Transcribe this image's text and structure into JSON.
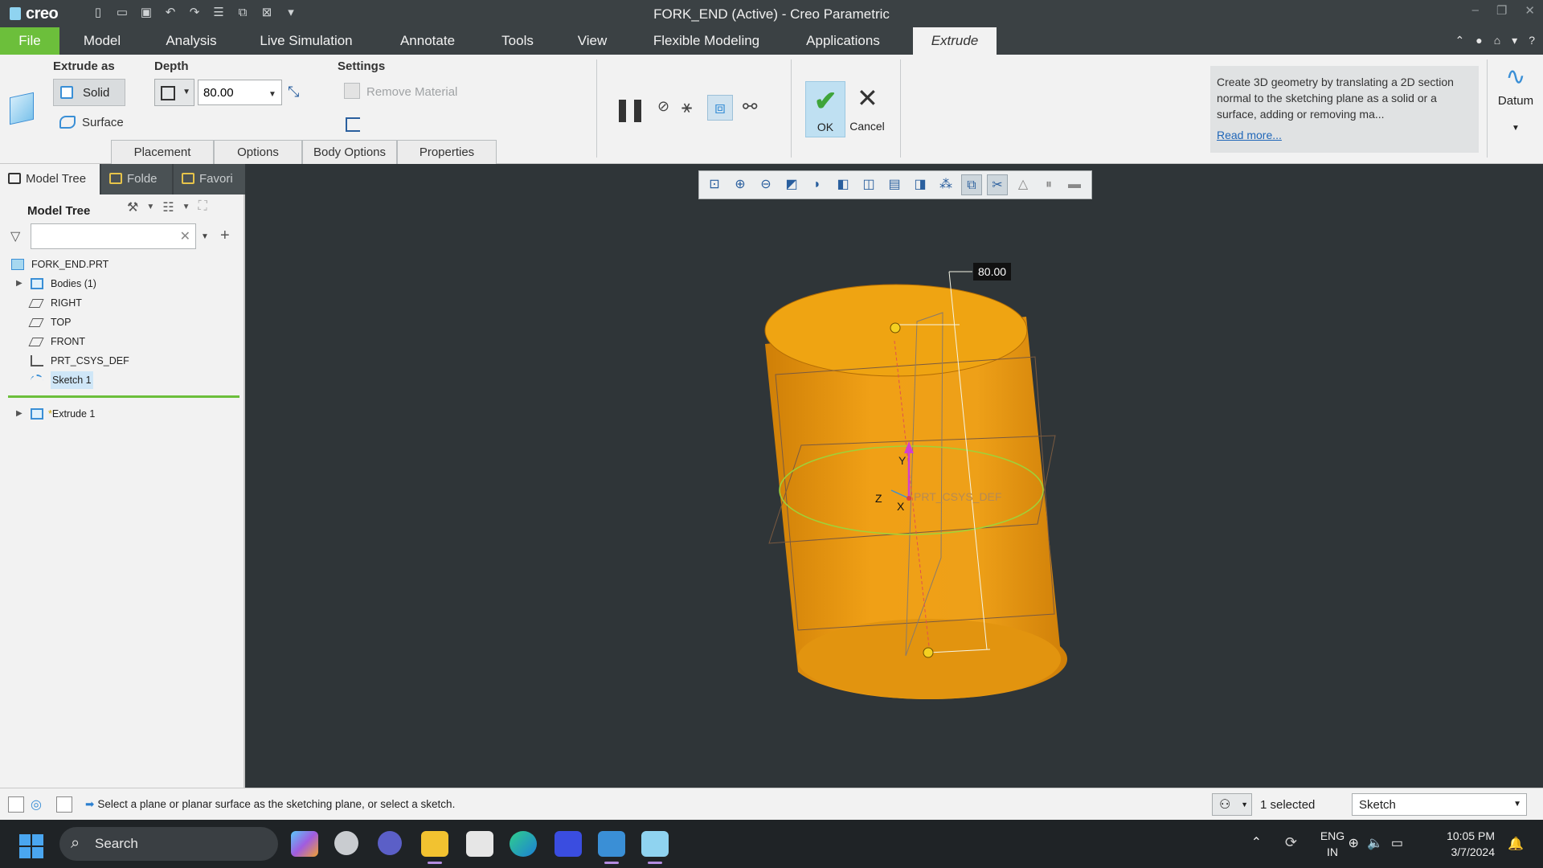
{
  "window": {
    "title": "FORK_END (Active) - Creo Parametric",
    "app_name": "creo",
    "accent_color": "#6cbf3b"
  },
  "ribbon_tabs": [
    "File",
    "Model",
    "Analysis",
    "Live Simulation",
    "Annotate",
    "Tools",
    "View",
    "Flexible Modeling",
    "Applications",
    "Extrude"
  ],
  "ribbon": {
    "extrude_as_label": "Extrude as",
    "solid_label": "Solid",
    "surface_label": "Surface",
    "depth_label": "Depth",
    "depth_value": "80.00",
    "settings_label": "Settings",
    "remove_material_label": "Remove Material",
    "ok_label": "OK",
    "cancel_label": "Cancel",
    "subtabs": [
      "Placement",
      "Options",
      "Body Options",
      "Properties"
    ],
    "help_text": "Create 3D geometry by translating a 2D section normal to the sketching plane as a solid or a surface, adding or removing ma...",
    "help_link": "Read more...",
    "datum_label": "Datum"
  },
  "left_panel": {
    "tabs": [
      "Model Tree",
      "Folde",
      "Favori"
    ],
    "tree_header": "Model Tree",
    "search_placeholder": "",
    "items": [
      {
        "label": "FORK_END.PRT",
        "icon": "part-icon"
      },
      {
        "label": "Bodies (1)",
        "icon": "bodies-icon"
      },
      {
        "label": "RIGHT",
        "icon": "datum-plane-icon"
      },
      {
        "label": "TOP",
        "icon": "datum-plane-icon"
      },
      {
        "label": "FRONT",
        "icon": "datum-plane-icon"
      },
      {
        "label": "PRT_CSYS_DEF",
        "icon": "csys-icon"
      },
      {
        "label": "Sketch 1",
        "icon": "sketch-icon"
      },
      {
        "label": "Extrude 1",
        "icon": "extrude-icon"
      }
    ]
  },
  "graphics": {
    "dimension_value": "80.00",
    "csys_label": "PRT_CSYS_DEF",
    "axis_y": "Y",
    "axis_z": "Z",
    "axis_x": "X",
    "model_color": "#f0a020",
    "background_color": "#2f3538"
  },
  "status": {
    "message": "Select a plane or planar surface as the sketching plane, or select a sketch.",
    "selected_count": "1 selected",
    "filter_value": "Sketch"
  },
  "taskbar": {
    "search_label": "Search",
    "lang_top": "ENG",
    "lang_bottom": "IN",
    "time": "10:05 PM",
    "date": "3/7/2024"
  }
}
